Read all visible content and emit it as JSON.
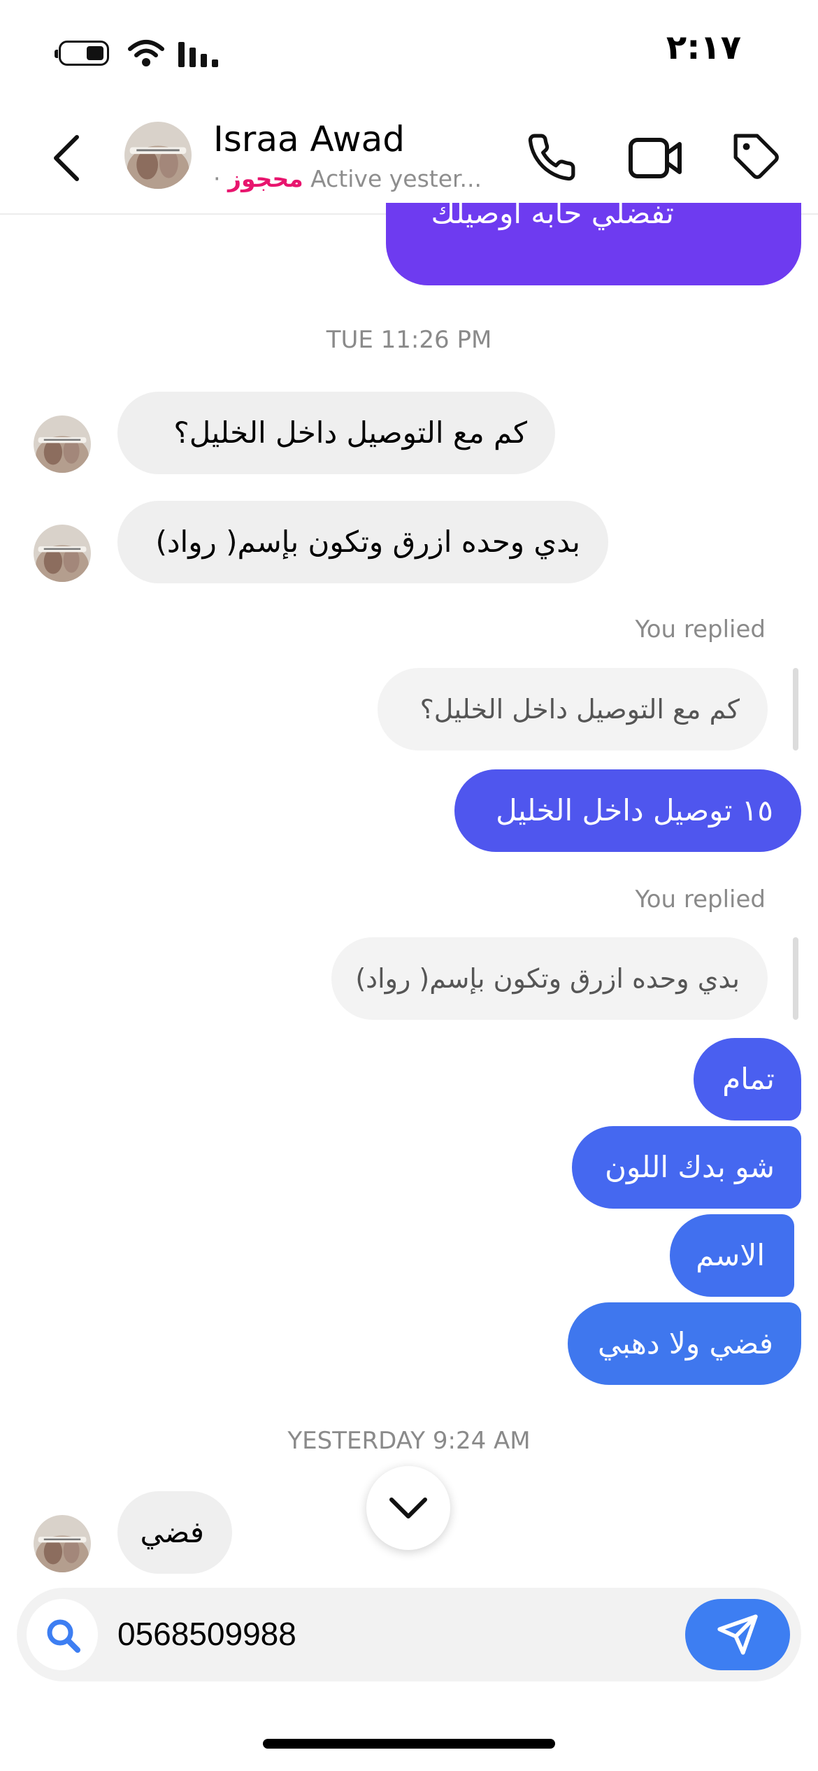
{
  "status_bar": {
    "time": "٢:١٧"
  },
  "header": {
    "contact_name": "Israa Awad",
    "status_tag": "محجوز",
    "status_text": "Active yester..."
  },
  "colors": {
    "accent_purple": "#6e3bf0",
    "accent_indigo": "#4f56ee",
    "accent_blue": "#3f77ee",
    "status_tag": "#e8156e",
    "incoming_bubble": "#efefef"
  },
  "messages": {
    "out_top": "تفضلي حابه اوصيلك",
    "stamp_1": "TUE 11:26 PM",
    "in_1": "كم مع التوصيل داخل الخليل؟",
    "in_2": "بدي وحده ازرق وتكون بإسم( رواد)",
    "replied_1": "You replied",
    "quote_1": "كم مع التوصيل داخل الخليل؟",
    "out_1": "١٥ توصيل داخل الخليل",
    "replied_2": "You replied",
    "quote_2": "بدي وحده ازرق وتكون بإسم( رواد)",
    "out_2": "تمام",
    "out_3": "شو بدك اللون",
    "out_4": "الاسم",
    "out_5": "فضي ولا دهبي",
    "stamp_2": "YESTERDAY 9:24 AM",
    "in_3": "فضي"
  },
  "composer": {
    "value": "0568509988"
  },
  "icons": {
    "back": "chevron-left-icon",
    "call": "phone-icon",
    "video": "video-camera-icon",
    "label": "tag-icon",
    "scroll": "chevron-down-icon",
    "search": "search-icon",
    "send": "send-icon"
  }
}
